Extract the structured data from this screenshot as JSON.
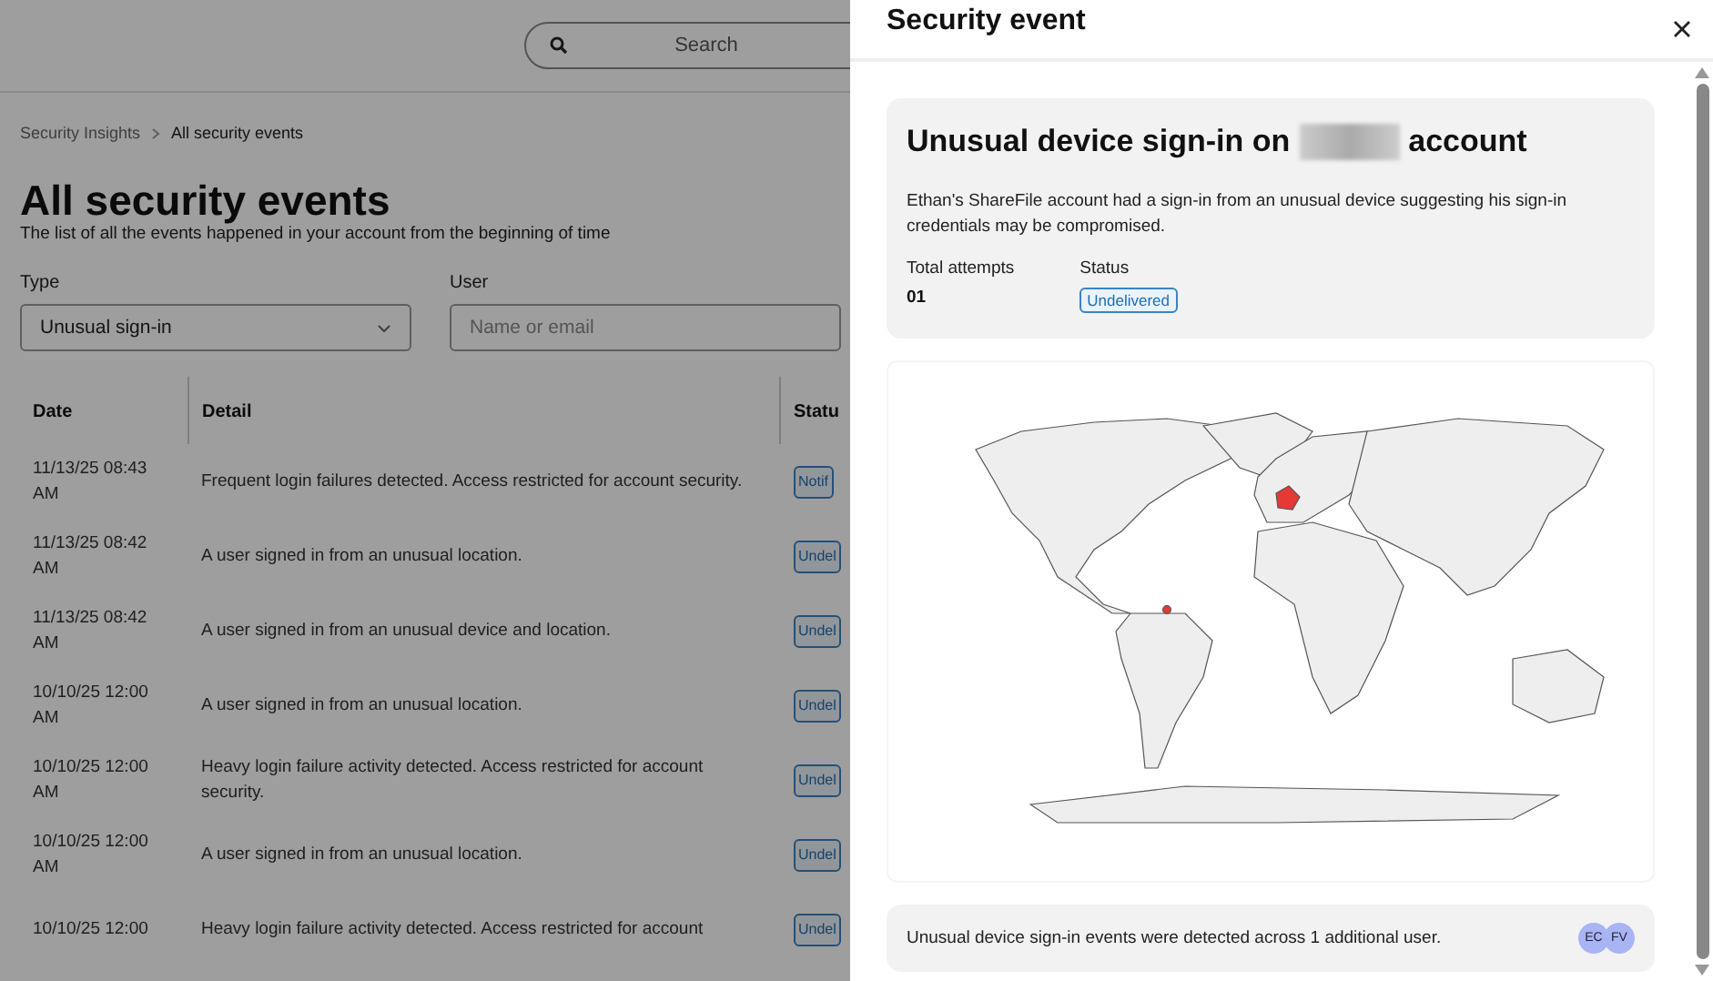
{
  "search": {
    "placeholder": "Search"
  },
  "breadcrumb": [
    {
      "label": "Security Insights"
    },
    {
      "label": "All security events"
    }
  ],
  "page": {
    "title": "All security events",
    "subtitle": "The list of all the events happened in your account from the beginning of time"
  },
  "filters": [
    {
      "label": "Type",
      "kind": "select",
      "value": "Unusual sign-in"
    },
    {
      "label": "User",
      "kind": "text",
      "placeholder": "Name or email"
    }
  ],
  "table": {
    "columns": [
      "Date",
      "Detail",
      "Statu"
    ],
    "rows": [
      {
        "date": "11/13/25 08:43 AM",
        "detail": "Frequent login failures detected. Access restricted for account security.",
        "status": "Notif"
      },
      {
        "date": "11/13/25 08:42 AM",
        "detail": "A user signed in from an unusual location.",
        "status": "Undel"
      },
      {
        "date": "11/13/25 08:42 AM",
        "detail": "A user signed in from an unusual device and location.",
        "status": "Undel"
      },
      {
        "date": "10/10/25 12:00 AM",
        "detail": "A user signed in from an unusual location.",
        "status": "Undel"
      },
      {
        "date": "10/10/25 12:00 AM",
        "detail": "Heavy login failure activity detected. Access restricted for account security.",
        "status": "Undel"
      },
      {
        "date": "10/10/25 12:00 AM",
        "detail": "A user signed in from an unusual location.",
        "status": "Undel"
      },
      {
        "date": "10/10/25 12:00",
        "detail": "Heavy login failure activity detected. Access restricted for account",
        "status": "Undel"
      }
    ]
  },
  "drawer": {
    "title": "Security event",
    "event": {
      "title_start": "Unusual device sign-in on",
      "title_end": "account",
      "description": "Ethan's ShareFile account had a sign-in from an unusual device suggesting his sign-in credentials may be compromised.",
      "fields": [
        {
          "label": "Total attempts",
          "kind": "text",
          "value": "01"
        },
        {
          "label": "Status",
          "kind": "badge",
          "value": "Undelivered"
        }
      ]
    },
    "summary": {
      "text": "Unusual device sign-in events were detected across 1 additional user.",
      "avatars": [
        {
          "initials": "EC"
        },
        {
          "initials": "FV"
        }
      ]
    }
  }
}
